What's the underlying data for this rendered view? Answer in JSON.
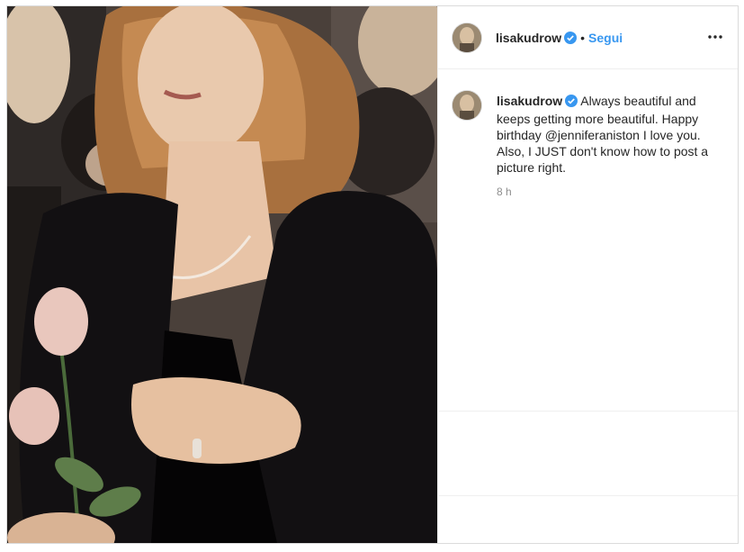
{
  "post": {
    "username": "lisakudrow",
    "follow_label": "Segui",
    "separator": "•",
    "caption_username": "lisakudrow",
    "caption_text": "Always beautiful and keeps getting more beautiful. Happy birthday @jenniferaniston I love you. Also, I JUST don't know how to post a picture right.",
    "timestamp": "8 h"
  },
  "colors": {
    "link": "#3897f0",
    "text": "#262626",
    "muted": "#8e8e8e",
    "border": "#dbdbdb"
  },
  "icons": [
    "verified-badge-icon",
    "more-options-icon"
  ]
}
